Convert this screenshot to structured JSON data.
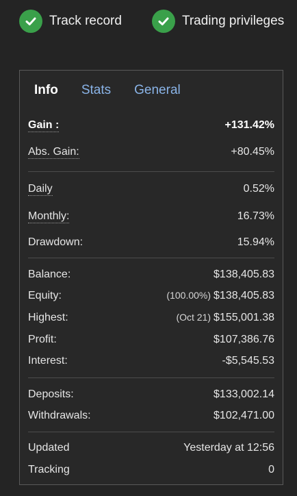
{
  "badges": [
    {
      "label": "Track record",
      "icon": "check-circle-icon",
      "color": "#3aa04a"
    },
    {
      "label": "Trading privileges",
      "icon": "check-circle-icon",
      "color": "#3aa04a"
    }
  ],
  "tabs": [
    {
      "label": "Info",
      "active": true
    },
    {
      "label": "Stats",
      "active": false
    },
    {
      "label": "General",
      "active": false
    }
  ],
  "info": {
    "gain": {
      "label": "Gain :",
      "value": "+131.42%"
    },
    "abs_gain": {
      "label": "Abs. Gain:",
      "value": "+80.45%"
    },
    "daily": {
      "label": "Daily",
      "value": "0.52%"
    },
    "monthly": {
      "label": "Monthly:",
      "value": "16.73%"
    },
    "drawdown": {
      "label": "Drawdown:",
      "value": "15.94%"
    },
    "balance": {
      "label": "Balance:",
      "value": "$138,405.83"
    },
    "equity": {
      "label": "Equity:",
      "prefix": "(100.00%)",
      "value": "$138,405.83"
    },
    "highest": {
      "label": "Highest:",
      "prefix": "(Oct 21)",
      "value": "$155,001.38"
    },
    "profit": {
      "label": "Profit:",
      "value": "$107,386.76"
    },
    "interest": {
      "label": "Interest:",
      "value": "-$5,545.53"
    },
    "deposits": {
      "label": "Deposits:",
      "value": "$133,002.14"
    },
    "withdrawals": {
      "label": "Withdrawals:",
      "value": "$102,471.00"
    },
    "updated": {
      "label": "Updated",
      "value": "Yesterday at 12:56"
    },
    "tracking": {
      "label": "Tracking",
      "value": "0"
    }
  }
}
